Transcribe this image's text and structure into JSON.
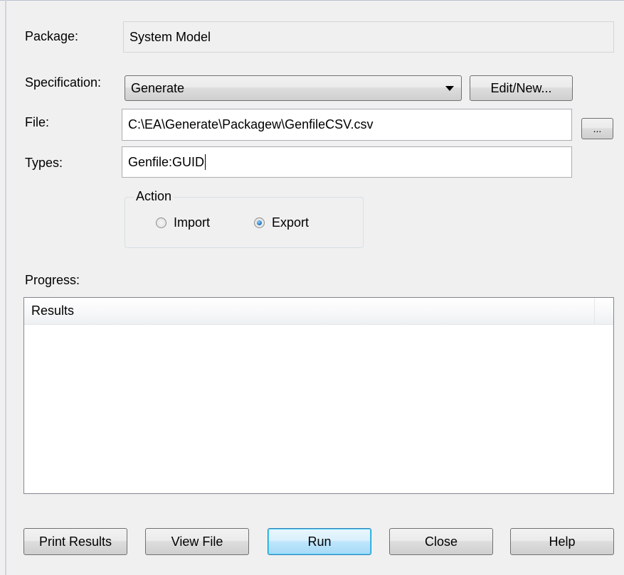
{
  "form": {
    "package_label": "Package:",
    "package_value": "System Model",
    "specification_label": "Specification:",
    "specification_value": "Generate",
    "edit_new_label": "Edit/New...",
    "file_label": "File:",
    "file_value": "C:\\EA\\Generate\\Packagew\\GenfileCSV.csv",
    "browse_label": "...",
    "types_label": "Types:",
    "types_value": "Genfile:GUID"
  },
  "action": {
    "title": "Action",
    "options": [
      {
        "label": "Import",
        "selected": false
      },
      {
        "label": "Export",
        "selected": true
      }
    ]
  },
  "progress": {
    "label": "Progress:",
    "columns": [
      "Results"
    ],
    "rows": []
  },
  "buttons": {
    "print_results": "Print Results",
    "view_file": "View File",
    "run": "Run",
    "close": "Close",
    "help": "Help"
  }
}
